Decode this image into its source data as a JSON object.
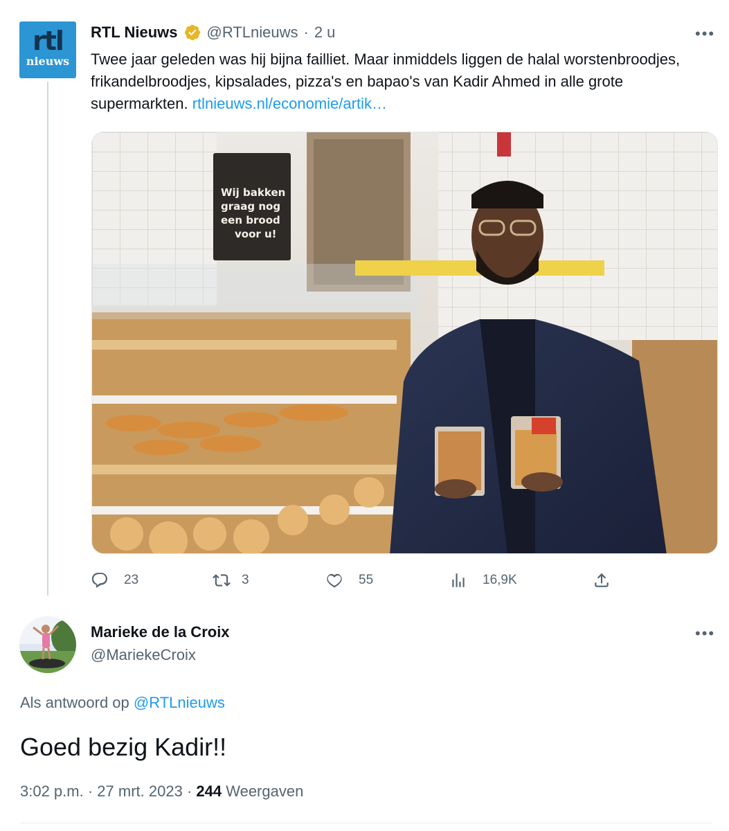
{
  "tweet": {
    "author_name": "RTL Nieuws",
    "handle": "@RTLnieuws",
    "separator": "·",
    "time": "2 u",
    "avatar_text_top": "rtl",
    "avatar_text_bottom": "nieuws",
    "text": "Twee jaar geleden was hij bijna failliet. Maar inmiddels liggen de halal worstenbroodjes, frikandelbroodjes, kipsalades, pizza's en bapao's van Kadir Ahmed in alle grote supermarkten. ",
    "link": "rtlnieuws.nl/economie/artik…",
    "media_sign": [
      "Wij bakken",
      "graag nog",
      "een brood",
      "voor u!"
    ],
    "actions": {
      "replies": "23",
      "retweets": "3",
      "likes": "55",
      "views": "16,9K"
    },
    "more_icon": "more-icon",
    "verified_icon": "verified-badge-icon"
  },
  "reply": {
    "author_name": "Marieke de la Croix",
    "handle": "@MariekeCroix",
    "reply_to_prefix": "Als antwoord op ",
    "reply_to_handle": "@RTLnieuws",
    "text": "Goed bezig Kadir!!",
    "time": "3:02 p.m.",
    "separator": "·",
    "date": "27 mrt. 2023",
    "separator2": "·",
    "views_count": "244",
    "views_label": " Weergaven"
  },
  "colors": {
    "accent": "#1d9bf0",
    "muted": "#536471",
    "verified": "#f4c430",
    "rtl_brand": "#2c95d3"
  }
}
